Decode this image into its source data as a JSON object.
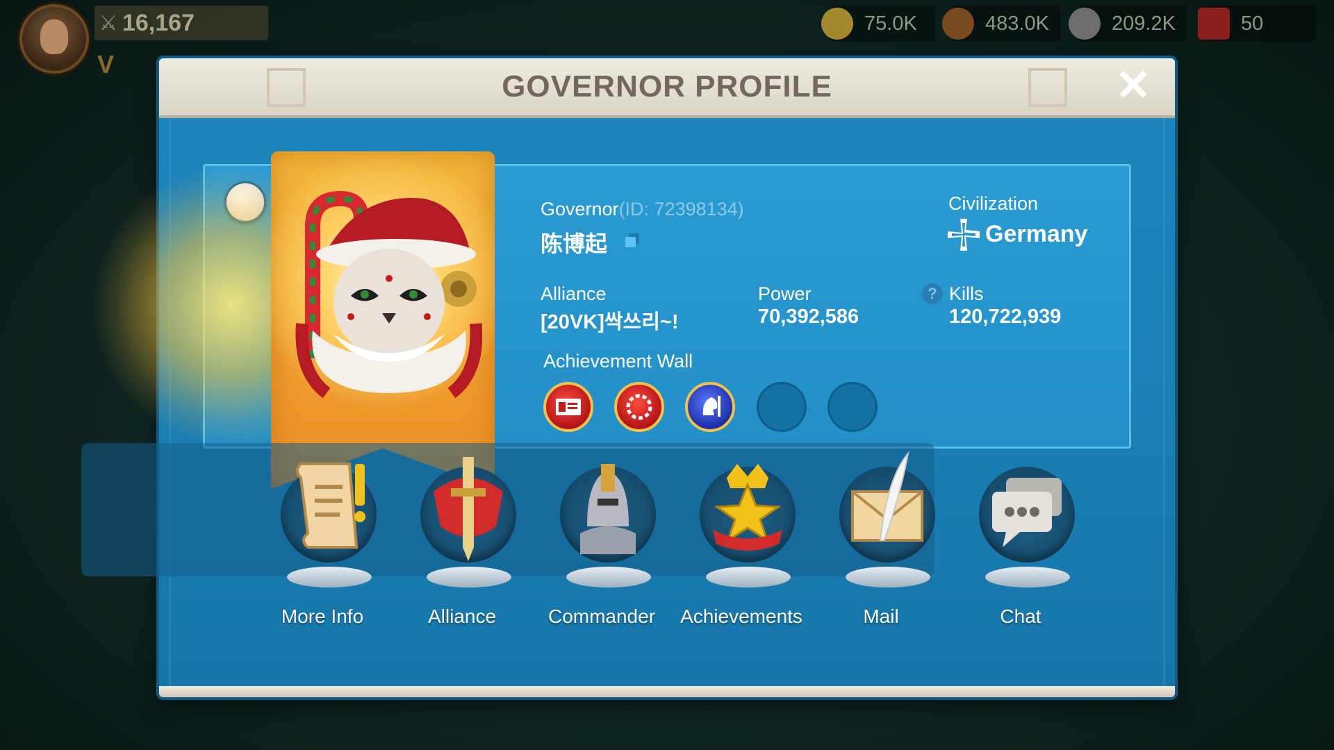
{
  "hud": {
    "power": "16,167",
    "vip": "V",
    "resources": [
      {
        "name": "food-icon",
        "value": "75.0K",
        "color": "#c6a43a"
      },
      {
        "name": "wood-icon",
        "value": "483.0K",
        "color": "#8a5a2a"
      },
      {
        "name": "stone-icon",
        "value": "209.2K",
        "color": "#8e8e8e"
      },
      {
        "name": "gems-icon",
        "value": "50",
        "color": "#b12626"
      }
    ]
  },
  "modal": {
    "title": "GOVERNOR PROFILE",
    "close_label": "✕"
  },
  "profile": {
    "governor_label": "Governor",
    "governor_id": "(ID: 72398134)",
    "name": "陈博起",
    "civilization_label": "Civilization",
    "civilization": "Germany",
    "alliance_label": "Alliance",
    "alliance": "[20VK]싹쓰리~!",
    "power_label": "Power",
    "power": "70,392,586",
    "kills_label": "Kills",
    "kills": "120,722,939",
    "help_label": "?",
    "achievement_wall_label": "Achievement Wall"
  },
  "achievements": [
    {
      "name": "id-card-badge-icon",
      "type": "red"
    },
    {
      "name": "laurel-wreath-badge-icon",
      "type": "red"
    },
    {
      "name": "knight-badge-icon",
      "type": "blue"
    },
    {
      "name": "empty-badge-slot",
      "type": "empty"
    },
    {
      "name": "empty-badge-slot",
      "type": "empty"
    }
  ],
  "actions": [
    {
      "label": "More Info",
      "icon": "scroll-icon"
    },
    {
      "label": "Alliance",
      "icon": "sword-shield-icon"
    },
    {
      "label": "Commander",
      "icon": "helmet-icon"
    },
    {
      "label": "Achievements",
      "icon": "crown-star-icon"
    },
    {
      "label": "Mail",
      "icon": "envelope-quill-icon"
    },
    {
      "label": "Chat",
      "icon": "chat-bubble-icon"
    }
  ]
}
